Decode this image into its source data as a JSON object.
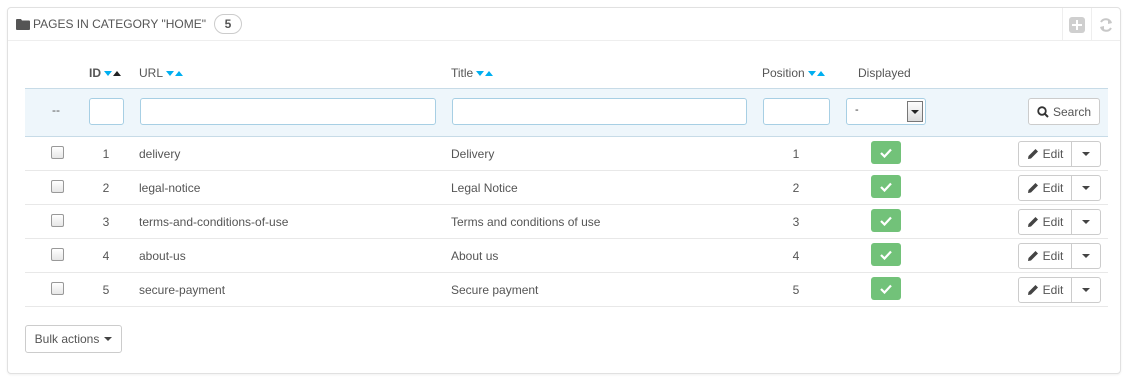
{
  "panel": {
    "title": "PAGES IN CATEGORY \"HOME\"",
    "count": "5",
    "tools": [
      "add-icon",
      "refresh-icon"
    ]
  },
  "columns": {
    "id": "ID",
    "url": "URL",
    "title": "Title",
    "position": "Position",
    "displayed": "Displayed"
  },
  "filters": {
    "placeholder_dash": "--",
    "displayed_select": "-",
    "search_label": "Search"
  },
  "rows": [
    {
      "id": "1",
      "url": "delivery",
      "title": "Delivery",
      "position": "1",
      "displayed": true
    },
    {
      "id": "2",
      "url": "legal-notice",
      "title": "Legal Notice",
      "position": "2",
      "displayed": true
    },
    {
      "id": "3",
      "url": "terms-and-conditions-of-use",
      "title": "Terms and conditions of use",
      "position": "3",
      "displayed": true
    },
    {
      "id": "4",
      "url": "about-us",
      "title": "About us",
      "position": "4",
      "displayed": true
    },
    {
      "id": "5",
      "url": "secure-payment",
      "title": "Secure payment",
      "position": "5",
      "displayed": true
    }
  ],
  "row_actions": {
    "edit_label": "Edit"
  },
  "footer": {
    "bulk_label": "Bulk actions"
  },
  "colors": {
    "accent": "#00aff0",
    "enabled": "#72c279",
    "filter_bg": "#eef6fb"
  }
}
